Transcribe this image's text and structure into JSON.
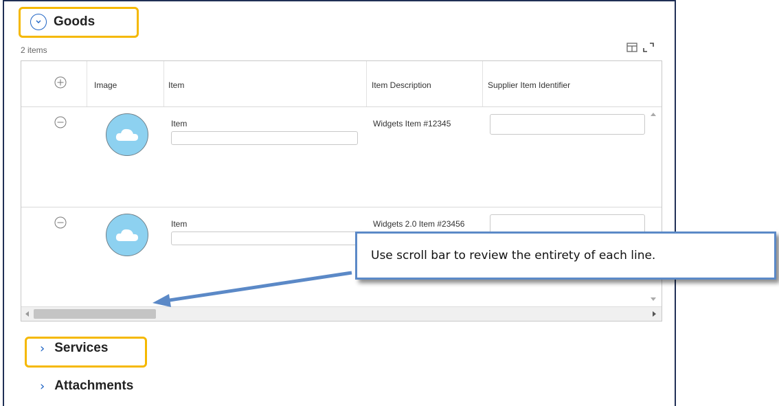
{
  "goods": {
    "title": "Goods",
    "item_count": "2 items",
    "columns": [
      "Image",
      "Item",
      "Item Description",
      "Supplier Item Identifier"
    ],
    "rows": [
      {
        "item_label": "Item",
        "item_value": "",
        "description": "Widgets Item #12345",
        "supplier_item_identifier": ""
      },
      {
        "item_label": "Item",
        "item_value": "",
        "description": "Widgets 2.0 Item #23456",
        "supplier_item_identifier": ""
      }
    ]
  },
  "sections": {
    "services": "Services",
    "attachments": "Attachments"
  },
  "annotation": {
    "callout_text": "Use scroll bar to review the entirety of each line."
  },
  "colors": {
    "highlight": "#f5b800",
    "accent": "#1e63c4",
    "callout_border": "#5b89c7",
    "image_placeholder": "#8dd1f0"
  },
  "icons": [
    "chevron-down-circle-icon",
    "add-row-icon",
    "remove-row-icon",
    "cloud-icon",
    "column-chooser-icon",
    "fullscreen-icon",
    "chevron-right-icon"
  ]
}
